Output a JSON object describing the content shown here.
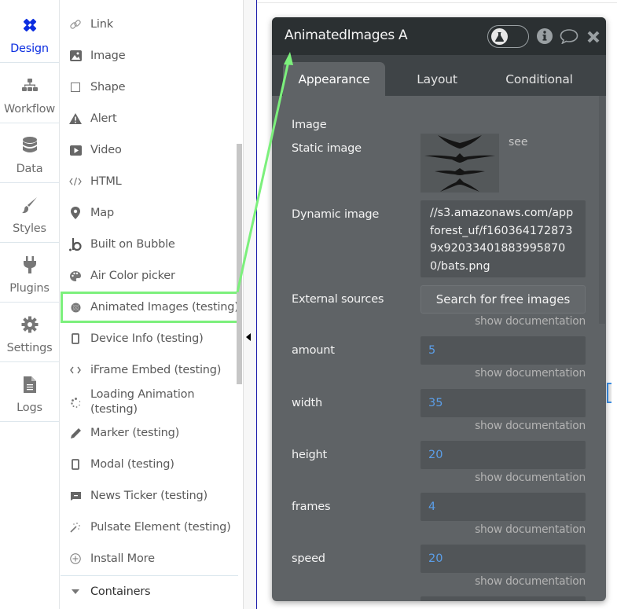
{
  "nav": {
    "items": [
      {
        "label": "Design",
        "icon": "design-pencil-ruler-icon",
        "active": true
      },
      {
        "label": "Workflow",
        "icon": "sitemap-icon",
        "active": false
      },
      {
        "label": "Data",
        "icon": "database-icon",
        "active": false
      },
      {
        "label": "Styles",
        "icon": "paintbrush-icon",
        "active": false
      },
      {
        "label": "Plugins",
        "icon": "plug-icon",
        "active": false
      },
      {
        "label": "Settings",
        "icon": "gear-icon",
        "active": false
      },
      {
        "label": "Logs",
        "icon": "document-icon",
        "active": false
      }
    ]
  },
  "palette": {
    "items": [
      {
        "label": "Link",
        "icon": "link-icon"
      },
      {
        "label": "Image",
        "icon": "image-icon"
      },
      {
        "label": "Shape",
        "icon": "square-icon"
      },
      {
        "label": "Alert",
        "icon": "warning-icon"
      },
      {
        "label": "Video",
        "icon": "play-icon"
      },
      {
        "label": "HTML",
        "icon": "code-icon"
      },
      {
        "label": "Map",
        "icon": "map-pin-icon"
      },
      {
        "label": "Built on Bubble",
        "icon": "bubble-logo-icon"
      },
      {
        "label": "Air Color picker",
        "icon": "palette-icon"
      },
      {
        "label": "Animated Images (testing)",
        "icon": "plugin-ball-icon",
        "highlighted": true
      },
      {
        "label": "Device Info (testing)",
        "icon": "mobile-icon"
      },
      {
        "label": "iFrame Embed (testing)",
        "icon": "angle-brackets-icon"
      },
      {
        "label": "Loading Animation (testing)",
        "icon": "spinner-icon"
      },
      {
        "label": "Marker (testing)",
        "icon": "pencil-icon"
      },
      {
        "label": "Modal (testing)",
        "icon": "mobile-icon"
      },
      {
        "label": "News Ticker (testing)",
        "icon": "comment-icon"
      },
      {
        "label": "Pulsate Element (testing)",
        "icon": "magic-wand-icon"
      },
      {
        "label": "Install More",
        "icon": "plus-circle-icon"
      }
    ],
    "section": {
      "label": "Containers",
      "icon": "caret-down-icon"
    }
  },
  "editor": {
    "title": "AnimatedImages A",
    "tabs": [
      "Appearance",
      "Layout",
      "Conditional"
    ],
    "active_tab": "Appearance",
    "section_label": "Image",
    "static_image_label": "Static image",
    "see_link": "see",
    "dynamic_image_label": "Dynamic image",
    "dynamic_image_value": "//s3.amazonaws.com/appforest_uf/f1603641728739x920334018839958700/bats.png",
    "external_sources_label": "External sources",
    "search_button": "Search for free images",
    "doc_link": "show documentation",
    "fields": [
      {
        "label": "amount",
        "value": "5"
      },
      {
        "label": "width",
        "value": "35"
      },
      {
        "label": "height",
        "value": "20"
      },
      {
        "label": "frames",
        "value": "4"
      },
      {
        "label": "speed",
        "value": "20"
      }
    ]
  },
  "colors": {
    "accent_active_nav": "#0b2de0",
    "highlight_green": "#7cf07c",
    "value_blue": "#5b9ee8",
    "editor_bg": "#5f6366",
    "editor_header": "#2b3032"
  }
}
